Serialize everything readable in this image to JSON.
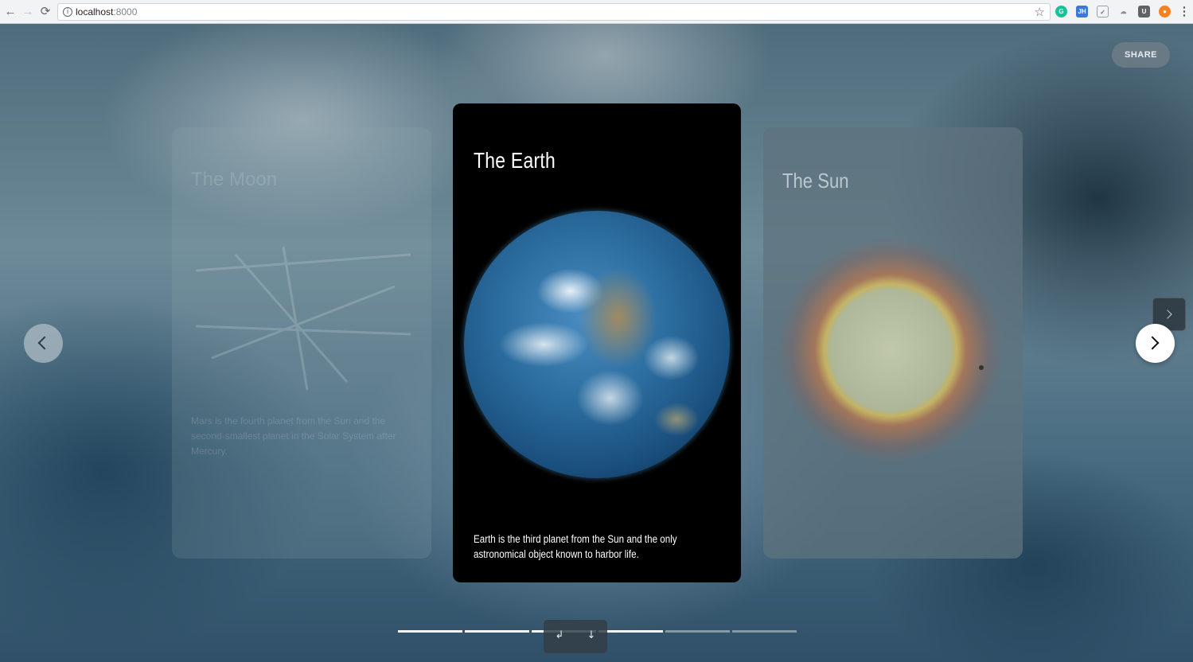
{
  "browser": {
    "url_host": "localhost",
    "url_port": ":8000"
  },
  "share_label": "SHARE",
  "cards": {
    "left": {
      "title": "The Moon",
      "description": "Mars is the fourth planet from the Sun and the second-smallest planet in the Solar System after Mercury."
    },
    "main": {
      "title": "The Earth",
      "description": "Earth is the third planet from the Sun and the only astronomical object known to harbor life."
    },
    "right": {
      "title": "The Sun"
    }
  },
  "progress": {
    "total_segments": 6,
    "active_segments": 4
  }
}
